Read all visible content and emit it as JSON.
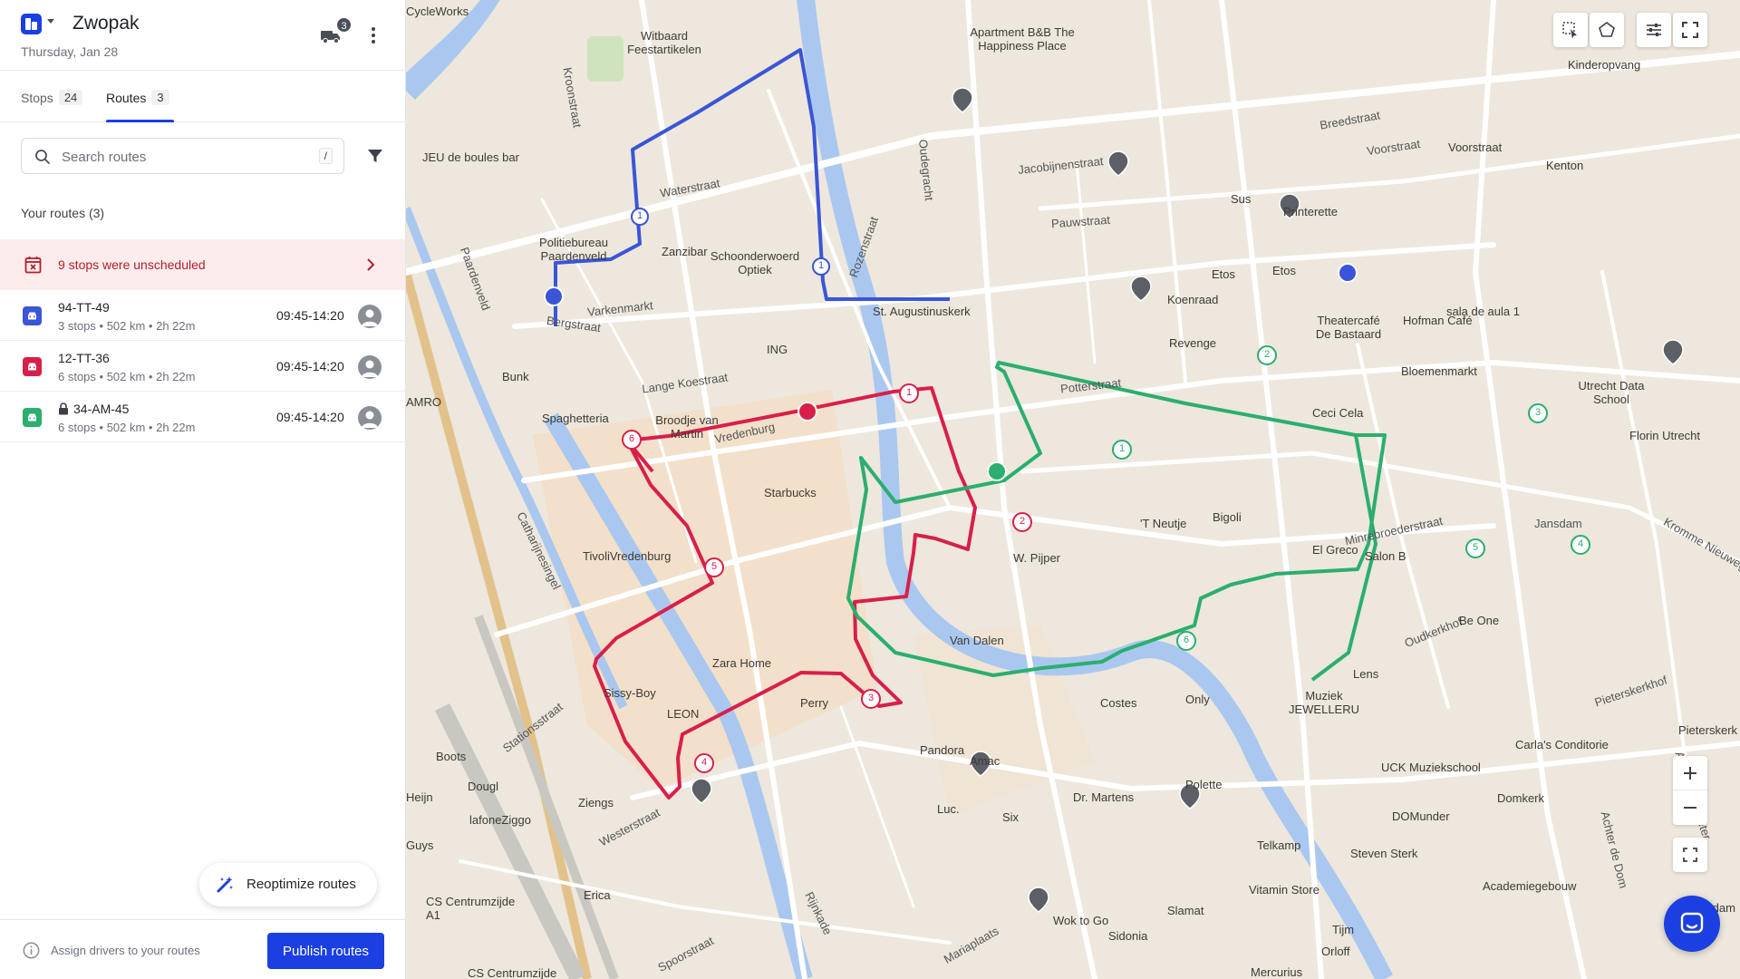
{
  "header": {
    "org_name": "Zwopak",
    "date": "Thursday, Jan 28",
    "truck_badge": "3"
  },
  "tabs": [
    {
      "label": "Stops",
      "count": "24"
    },
    {
      "label": "Routes",
      "count": "3"
    }
  ],
  "search": {
    "placeholder": "Search routes",
    "shortcut": "/"
  },
  "section_title": "Your routes (3)",
  "alert": {
    "text": "9 stops were unscheduled"
  },
  "routes": [
    {
      "name": "94-TT-49",
      "meta": "3 stops • 502 km • 2h 22m",
      "time": "09:45-14:20",
      "color": "#3a55d6",
      "locked": false
    },
    {
      "name": "12-TT-36",
      "meta": "6 stops • 502 km • 2h 22m",
      "time": "09:45-14:20",
      "color": "#d81f4a",
      "locked": false
    },
    {
      "name": "34-AM-45",
      "meta": "6 stops • 502 km • 2h 22m",
      "time": "09:45-14:20",
      "color": "#2bae6e",
      "locked": true
    }
  ],
  "reoptimize_label": "Reoptimize routes",
  "footer": {
    "assign_text": "Assign drivers to your routes",
    "publish_label": "Publish routes"
  },
  "colors": {
    "primary": "#1b3fe0",
    "route_blue": "#3a55d6",
    "route_red": "#d81f4a",
    "route_green": "#2bae6e",
    "water": "#aac8ef",
    "map_bg": "#ede7dd",
    "alert_bg": "#fdecec",
    "alert_text": "#b21f2d"
  },
  "map": {
    "streets": [
      "Waterstraat",
      "Bergstraat",
      "Varkenmarkt",
      "Kroonstraat",
      "Paardenveld",
      "Lange Koestraat",
      "Catharijnesingel",
      "Vredenburg",
      "Rozenstraat",
      "Voorstraat",
      "Jacobijnenstraat",
      "Pauwstraat",
      "Breedstraat",
      "Potterstraat",
      "Minrebroederstraat",
      "Oudkerkhof",
      "Jansdam",
      "Stationsstraat",
      "Westerstraat",
      "Spoorstraat",
      "Rijnkade",
      "Mariaplaats",
      "Achter Sint Pieter",
      "Kromme Nieuwegracht",
      "Pieterskerkhof",
      "Oudegracht",
      "Achter de Dom"
    ],
    "pois": [
      "CycleWorks",
      "Witbaard Feestartikelen",
      "Apartment B&B The Happiness Place",
      "JEU de boules bar",
      "Politiebureau Paardenveld",
      "Zanzibar",
      "Schoonderwoerd Optiek",
      "St. Augustinuskerk",
      "ING",
      "Bunk",
      "Spaghetteria",
      "Broodje van Martin",
      "Starbucks",
      "TivoliVredenburg",
      "Zara Home",
      "LEON",
      "Perry",
      "Sissy-Boy",
      "Boots",
      "Dougl",
      "Heijn",
      "Ziengs",
      "lafoneZiggo",
      "Guys",
      "Erica",
      "CS Centrumzijde",
      "CS Centrumzijde A1",
      "Sus",
      "Printerette",
      "Kenton",
      "Voorstraat",
      "Etos",
      "Koenraad",
      "Revenge",
      "Theatercafé De Bastaard",
      "Hofman Café",
      "sala de aula 1",
      "Bloemenmarkt",
      "Ceci Cela",
      "Utrecht Data School",
      "Florin Utrecht",
      "'T Neutje",
      "Bigoli",
      "El Greco",
      "Salon B",
      "Be One",
      "Lens",
      "W. Pijper",
      "Van Dalen",
      "Costes",
      "Only",
      "Muziek JEWELLERU",
      "Pandora",
      "Amac",
      "Dr. Martens",
      "Polette",
      "UCK Muziekschool",
      "Domkerk",
      "DOMunder",
      "Telkamp",
      "Steven Sterk",
      "Academiegebouw",
      "Vitamin Store",
      "Slamat",
      "Wok to Go",
      "Sidonia",
      "Tijm",
      "Orloff",
      "Mercurius",
      "Carla's Conditorie",
      "Pieterskerk",
      "Pausdam",
      "Kinderopvang",
      "Etos",
      "Six",
      "Luc.",
      "AMRO"
    ],
    "blue_stops": [
      "1",
      "1",
      "1"
    ],
    "red_stops": [
      "1",
      "2",
      "3",
      "4",
      "5",
      "6"
    ],
    "green_stops": [
      "1",
      "2",
      "3",
      "4",
      "5",
      "6"
    ]
  }
}
